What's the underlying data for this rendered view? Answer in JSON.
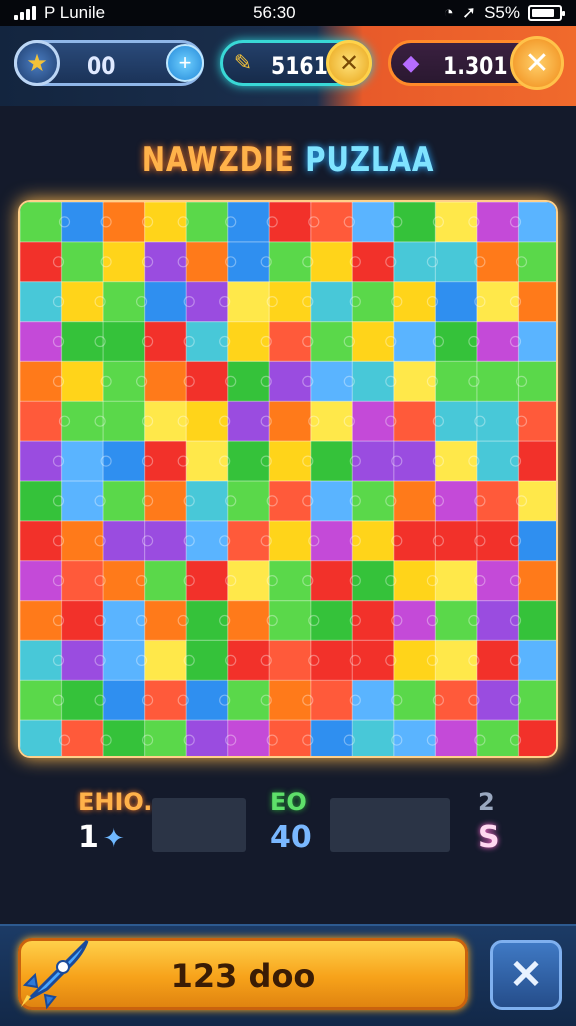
{
  "status_bar": {
    "carrier": "P Lunile",
    "time": "56:30",
    "battery_pct": "S5%",
    "battery_level": 0.85
  },
  "hud": {
    "star_value": "00",
    "coin_value": "5161",
    "gem_value": "1.301",
    "star_icon": "star-icon",
    "plus_icon": "plus-icon",
    "coin_icon": "pencil-icon",
    "gem_icon": "gem-icon",
    "accent_teal": "#39d8d6",
    "accent_orange": "#ff8a2a"
  },
  "title": {
    "part1": "NAWZDIE",
    "part2": "PUZLAA"
  },
  "stats": {
    "left_label": "EHIO.",
    "left_value": "1",
    "middle_label": "EO",
    "middle_value": "40",
    "right_label": "2",
    "right_value": "S"
  },
  "play_button": {
    "label": "123 doo"
  },
  "close_button": {
    "label": "✕"
  },
  "board": {
    "columns": 13,
    "rows": 14
  }
}
